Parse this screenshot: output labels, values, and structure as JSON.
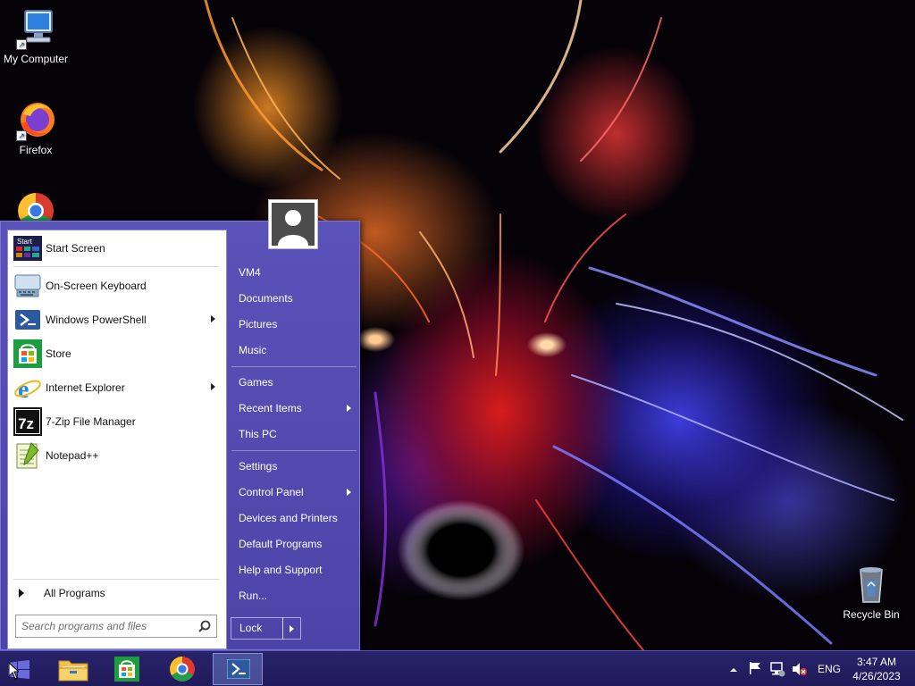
{
  "desktop": {
    "icons": [
      {
        "label": "My Computer"
      },
      {
        "label": "Firefox"
      },
      {
        "label": "Google Chrome"
      },
      {
        "label": "Recycle Bin"
      }
    ]
  },
  "start_menu": {
    "programs": [
      {
        "label": "Start Screen",
        "icon": "start-screen-icon",
        "submenu": false
      },
      {
        "label": "On-Screen Keyboard",
        "icon": "keyboard-icon",
        "submenu": false
      },
      {
        "label": "Windows PowerShell",
        "icon": "powershell-icon",
        "submenu": true
      },
      {
        "label": "Store",
        "icon": "store-icon",
        "submenu": false
      },
      {
        "label": "Internet Explorer",
        "icon": "internet-explorer-icon",
        "submenu": true
      },
      {
        "label": "7-Zip File Manager",
        "icon": "seven-zip-icon",
        "submenu": false
      },
      {
        "label": "Notepad++",
        "icon": "notepad-plus-plus-icon",
        "submenu": false
      }
    ],
    "all_programs_label": "All Programs",
    "search_placeholder": "Search programs and files",
    "start_tile_text": "Start",
    "seven_zip_text": "7z",
    "right_items": [
      {
        "label": "VM4",
        "submenu": false
      },
      {
        "label": "Documents",
        "submenu": false
      },
      {
        "label": "Pictures",
        "submenu": false
      },
      {
        "label": "Music",
        "submenu": false
      },
      {
        "label": "Games",
        "submenu": false
      },
      {
        "label": "Recent Items",
        "submenu": true
      },
      {
        "label": "This PC",
        "submenu": false
      },
      {
        "label": "Settings",
        "submenu": false
      },
      {
        "label": "Control Panel",
        "submenu": true
      },
      {
        "label": "Devices and Printers",
        "submenu": false
      },
      {
        "label": "Default Programs",
        "submenu": false
      },
      {
        "label": "Help and Support",
        "submenu": false
      },
      {
        "label": "Run...",
        "submenu": false
      }
    ],
    "lock_label": "Lock"
  },
  "taskbar": {
    "pinned": [
      {
        "name": "start-button",
        "icon": "windows-logo-icon"
      },
      {
        "name": "file-explorer-button",
        "icon": "folder-icon"
      },
      {
        "name": "store-button",
        "icon": "store-icon"
      },
      {
        "name": "chrome-button",
        "icon": "chrome-icon"
      },
      {
        "name": "powershell-button",
        "icon": "powershell-icon",
        "active": true
      }
    ],
    "tray": {
      "language": "ENG",
      "time": "3:47 AM",
      "date": "4/26/2023"
    }
  },
  "colors": {
    "menu_bg": "#5046aa",
    "taskbar_bg": "#261f64",
    "accent": "#7c76d6"
  }
}
